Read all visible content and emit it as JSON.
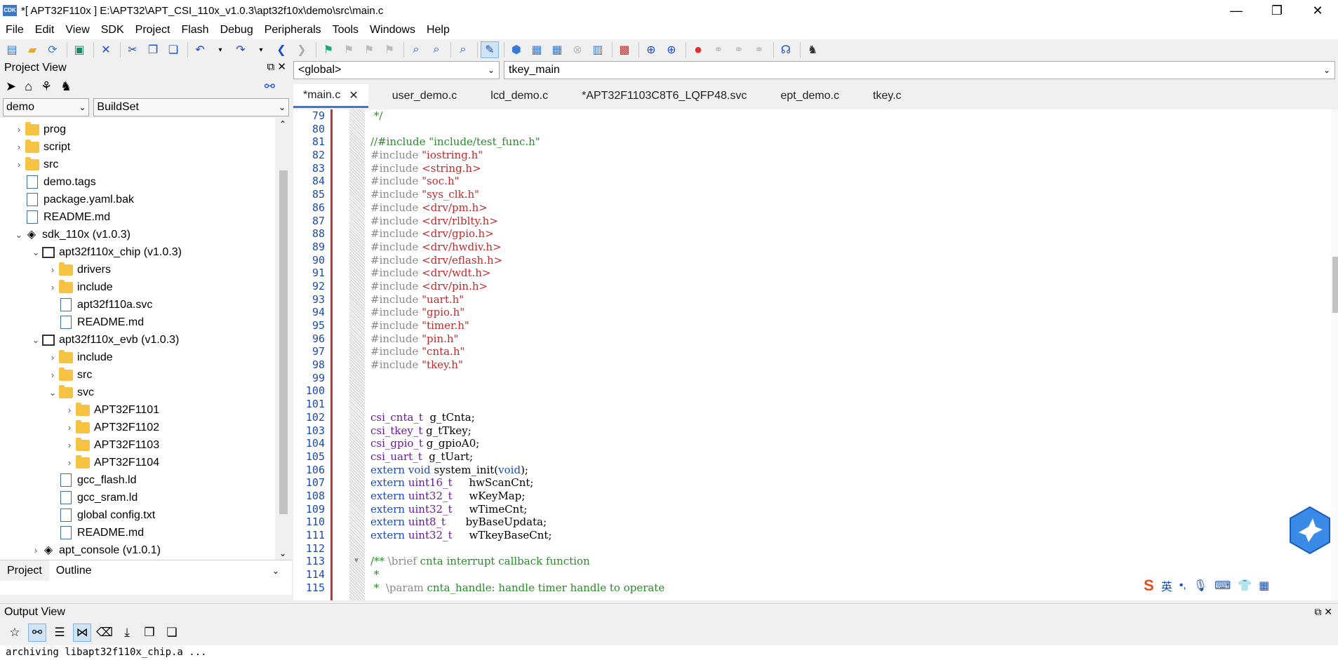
{
  "window": {
    "title": "*[ APT32F110x ] E:\\APT32\\APT_CSI_110x_v1.0.3\\apt32f10x\\demo\\src\\main.c",
    "app_icon_text": "CDK",
    "minimize": "—",
    "maximize": "❐",
    "close": "✕"
  },
  "menu": [
    "File",
    "Edit",
    "View",
    "SDK",
    "Project",
    "Flash",
    "Debug",
    "Peripherals",
    "Tools",
    "Windows",
    "Help"
  ],
  "project_view": {
    "title": "Project View",
    "pin": "⧉",
    "close": "✕",
    "project_select": "demo",
    "build_select": "BuildSet",
    "tree": [
      {
        "indent": 1,
        "chev": "›",
        "kind": "folder",
        "label": "prog"
      },
      {
        "indent": 1,
        "chev": "›",
        "kind": "folder",
        "label": "script"
      },
      {
        "indent": 1,
        "chev": "›",
        "kind": "folder",
        "label": "src"
      },
      {
        "indent": 1,
        "chev": "",
        "kind": "file",
        "label": "demo.tags"
      },
      {
        "indent": 1,
        "chev": "",
        "kind": "file",
        "label": "package.yaml.bak"
      },
      {
        "indent": 1,
        "chev": "",
        "kind": "file",
        "label": "README.md"
      },
      {
        "indent": 1,
        "chev": "⌄",
        "kind": "pkg",
        "label": "sdk_110x (v1.0.3)"
      },
      {
        "indent": 2,
        "chev": "⌄",
        "kind": "chip",
        "label": "apt32f110x_chip (v1.0.3)"
      },
      {
        "indent": 3,
        "chev": "›",
        "kind": "folder",
        "label": "drivers"
      },
      {
        "indent": 3,
        "chev": "›",
        "kind": "folder",
        "label": "include"
      },
      {
        "indent": 3,
        "chev": "",
        "kind": "file",
        "label": "apt32f110a.svc"
      },
      {
        "indent": 3,
        "chev": "",
        "kind": "file",
        "label": "README.md"
      },
      {
        "indent": 2,
        "chev": "⌄",
        "kind": "chip",
        "label": "apt32f110x_evb (v1.0.3)"
      },
      {
        "indent": 3,
        "chev": "›",
        "kind": "folder",
        "label": "include"
      },
      {
        "indent": 3,
        "chev": "›",
        "kind": "folder",
        "label": "src"
      },
      {
        "indent": 3,
        "chev": "⌄",
        "kind": "folder",
        "label": "svc"
      },
      {
        "indent": 4,
        "chev": "›",
        "kind": "folder",
        "label": "APT32F1101"
      },
      {
        "indent": 4,
        "chev": "›",
        "kind": "folder",
        "label": "APT32F1102"
      },
      {
        "indent": 4,
        "chev": "›",
        "kind": "folder",
        "label": "APT32F1103"
      },
      {
        "indent": 4,
        "chev": "›",
        "kind": "folder",
        "label": "APT32F1104"
      },
      {
        "indent": 3,
        "chev": "",
        "kind": "file",
        "label": "gcc_flash.ld"
      },
      {
        "indent": 3,
        "chev": "",
        "kind": "file",
        "label": "gcc_sram.ld"
      },
      {
        "indent": 3,
        "chev": "",
        "kind": "file",
        "label": "global config.txt"
      },
      {
        "indent": 3,
        "chev": "",
        "kind": "file",
        "label": "README.md"
      },
      {
        "indent": 2,
        "chev": "›",
        "kind": "pkg",
        "label": "apt_console (v1.0.1)"
      }
    ],
    "bottom_tabs": [
      "Project",
      "Outline"
    ]
  },
  "editor": {
    "scope_combo": "<global>",
    "function_combo": "tkey_main",
    "tabs": [
      {
        "label": "*main.c",
        "active": true
      },
      {
        "label": "user_demo.c",
        "active": false
      },
      {
        "label": "lcd_demo.c",
        "active": false
      },
      {
        "label": "*APT32F1103C8T6_LQFP48.svc",
        "active": false
      },
      {
        "label": "ept_demo.c",
        "active": false
      },
      {
        "label": "tkey.c",
        "active": false
      }
    ],
    "tab_close": "✕",
    "lines": [
      {
        "n": "79",
        "parts": [
          {
            "c": "c-green",
            "t": " */"
          }
        ]
      },
      {
        "n": "80",
        "parts": []
      },
      {
        "n": "81",
        "parts": [
          {
            "c": "c-green",
            "t": "//#include \"include/test_func.h\""
          }
        ]
      },
      {
        "n": "82",
        "parts": [
          {
            "c": "c-inc",
            "t": "#include "
          },
          {
            "c": "c-str",
            "t": "\"iostring.h\""
          }
        ]
      },
      {
        "n": "83",
        "parts": [
          {
            "c": "c-inc",
            "t": "#include "
          },
          {
            "c": "c-str",
            "t": "<string.h>"
          }
        ]
      },
      {
        "n": "84",
        "parts": [
          {
            "c": "c-inc",
            "t": "#include "
          },
          {
            "c": "c-str",
            "t": "\"soc.h\""
          }
        ]
      },
      {
        "n": "85",
        "parts": [
          {
            "c": "c-inc",
            "t": "#include "
          },
          {
            "c": "c-str",
            "t": "\"sys_clk.h\""
          }
        ]
      },
      {
        "n": "86",
        "parts": [
          {
            "c": "c-inc",
            "t": "#include "
          },
          {
            "c": "c-str",
            "t": "<drv/pm.h>"
          }
        ]
      },
      {
        "n": "87",
        "parts": [
          {
            "c": "c-inc",
            "t": "#include "
          },
          {
            "c": "c-str",
            "t": "<drv/rlblty.h>"
          }
        ]
      },
      {
        "n": "88",
        "parts": [
          {
            "c": "c-inc",
            "t": "#include "
          },
          {
            "c": "c-str",
            "t": "<drv/gpio.h>"
          }
        ]
      },
      {
        "n": "89",
        "parts": [
          {
            "c": "c-inc",
            "t": "#include "
          },
          {
            "c": "c-str",
            "t": "<drv/hwdiv.h>"
          }
        ]
      },
      {
        "n": "90",
        "parts": [
          {
            "c": "c-inc",
            "t": "#include "
          },
          {
            "c": "c-str",
            "t": "<drv/eflash.h>"
          }
        ]
      },
      {
        "n": "91",
        "parts": [
          {
            "c": "c-inc",
            "t": "#include "
          },
          {
            "c": "c-str",
            "t": "<drv/wdt.h>"
          }
        ]
      },
      {
        "n": "92",
        "parts": [
          {
            "c": "c-inc",
            "t": "#include "
          },
          {
            "c": "c-str",
            "t": "<drv/pin.h>"
          }
        ]
      },
      {
        "n": "93",
        "parts": [
          {
            "c": "c-inc",
            "t": "#include "
          },
          {
            "c": "c-str",
            "t": "\"uart.h\""
          }
        ]
      },
      {
        "n": "94",
        "parts": [
          {
            "c": "c-inc",
            "t": "#include "
          },
          {
            "c": "c-str",
            "t": "\"gpio.h\""
          }
        ]
      },
      {
        "n": "95",
        "parts": [
          {
            "c": "c-inc",
            "t": "#include "
          },
          {
            "c": "c-str",
            "t": "\"timer.h\""
          }
        ]
      },
      {
        "n": "96",
        "parts": [
          {
            "c": "c-inc",
            "t": "#include "
          },
          {
            "c": "c-str",
            "t": "\"pin.h\""
          }
        ]
      },
      {
        "n": "97",
        "parts": [
          {
            "c": "c-inc",
            "t": "#include "
          },
          {
            "c": "c-str",
            "t": "\"cnta.h\""
          }
        ]
      },
      {
        "n": "98",
        "parts": [
          {
            "c": "c-inc",
            "t": "#include "
          },
          {
            "c": "c-str",
            "t": "\"tkey.h\""
          }
        ]
      },
      {
        "n": "99",
        "parts": []
      },
      {
        "n": "100",
        "parts": []
      },
      {
        "n": "101",
        "parts": []
      },
      {
        "n": "102",
        "parts": [
          {
            "c": "c-type",
            "t": "csi_cnta_t"
          },
          {
            "c": "c-plain",
            "t": "  g_tCnta;"
          }
        ]
      },
      {
        "n": "103",
        "parts": [
          {
            "c": "c-type",
            "t": "csi_tkey_t"
          },
          {
            "c": "c-plain",
            "t": " g_tTkey;"
          }
        ]
      },
      {
        "n": "104",
        "parts": [
          {
            "c": "c-type",
            "t": "csi_gpio_t"
          },
          {
            "c": "c-plain",
            "t": " g_gpioA0;"
          }
        ]
      },
      {
        "n": "105",
        "parts": [
          {
            "c": "c-type",
            "t": "csi_uart_t"
          },
          {
            "c": "c-plain",
            "t": "  g_tUart;"
          }
        ]
      },
      {
        "n": "106",
        "parts": [
          {
            "c": "c-kw",
            "t": "extern void"
          },
          {
            "c": "c-plain",
            "t": " system_init("
          },
          {
            "c": "c-kw",
            "t": "void"
          },
          {
            "c": "c-plain",
            "t": ");"
          }
        ]
      },
      {
        "n": "107",
        "parts": [
          {
            "c": "c-kw",
            "t": "extern"
          },
          {
            "c": "c-type",
            "t": " uint16_t"
          },
          {
            "c": "c-plain",
            "t": "     hwScanCnt;"
          }
        ]
      },
      {
        "n": "108",
        "parts": [
          {
            "c": "c-kw",
            "t": "extern"
          },
          {
            "c": "c-type",
            "t": " uint32_t"
          },
          {
            "c": "c-plain",
            "t": "     wKeyMap;"
          }
        ]
      },
      {
        "n": "109",
        "parts": [
          {
            "c": "c-kw",
            "t": "extern"
          },
          {
            "c": "c-type",
            "t": " uint32_t"
          },
          {
            "c": "c-plain",
            "t": "     wTimeCnt;"
          }
        ]
      },
      {
        "n": "110",
        "parts": [
          {
            "c": "c-kw",
            "t": "extern"
          },
          {
            "c": "c-type",
            "t": " uint8_t"
          },
          {
            "c": "c-plain",
            "t": "      byBaseUpdata;"
          }
        ]
      },
      {
        "n": "111",
        "parts": [
          {
            "c": "c-kw",
            "t": "extern"
          },
          {
            "c": "c-type",
            "t": " uint32_t"
          },
          {
            "c": "c-plain",
            "t": "     wTkeyBaseCnt;"
          }
        ]
      },
      {
        "n": "112",
        "parts": []
      },
      {
        "n": "113",
        "parts": [
          {
            "c": "c-doc",
            "t": "/** "
          },
          {
            "c": "c-inc",
            "t": "\\brief"
          },
          {
            "c": "c-doc",
            "t": " cnta interrupt callback function"
          }
        ]
      },
      {
        "n": "114",
        "parts": [
          {
            "c": "c-doc",
            "t": " *"
          }
        ]
      },
      {
        "n": "115",
        "parts": [
          {
            "c": "c-doc",
            "t": " *  "
          },
          {
            "c": "c-inc",
            "t": "\\param"
          },
          {
            "c": "c-doc",
            "t": " cnta_handle: handle timer handle to operate"
          }
        ]
      }
    ]
  },
  "ime": {
    "logo": "S",
    "lang": "英"
  },
  "output_view": {
    "title": "Output View",
    "text": "archiving libapt32f110x_chip.a ..."
  }
}
